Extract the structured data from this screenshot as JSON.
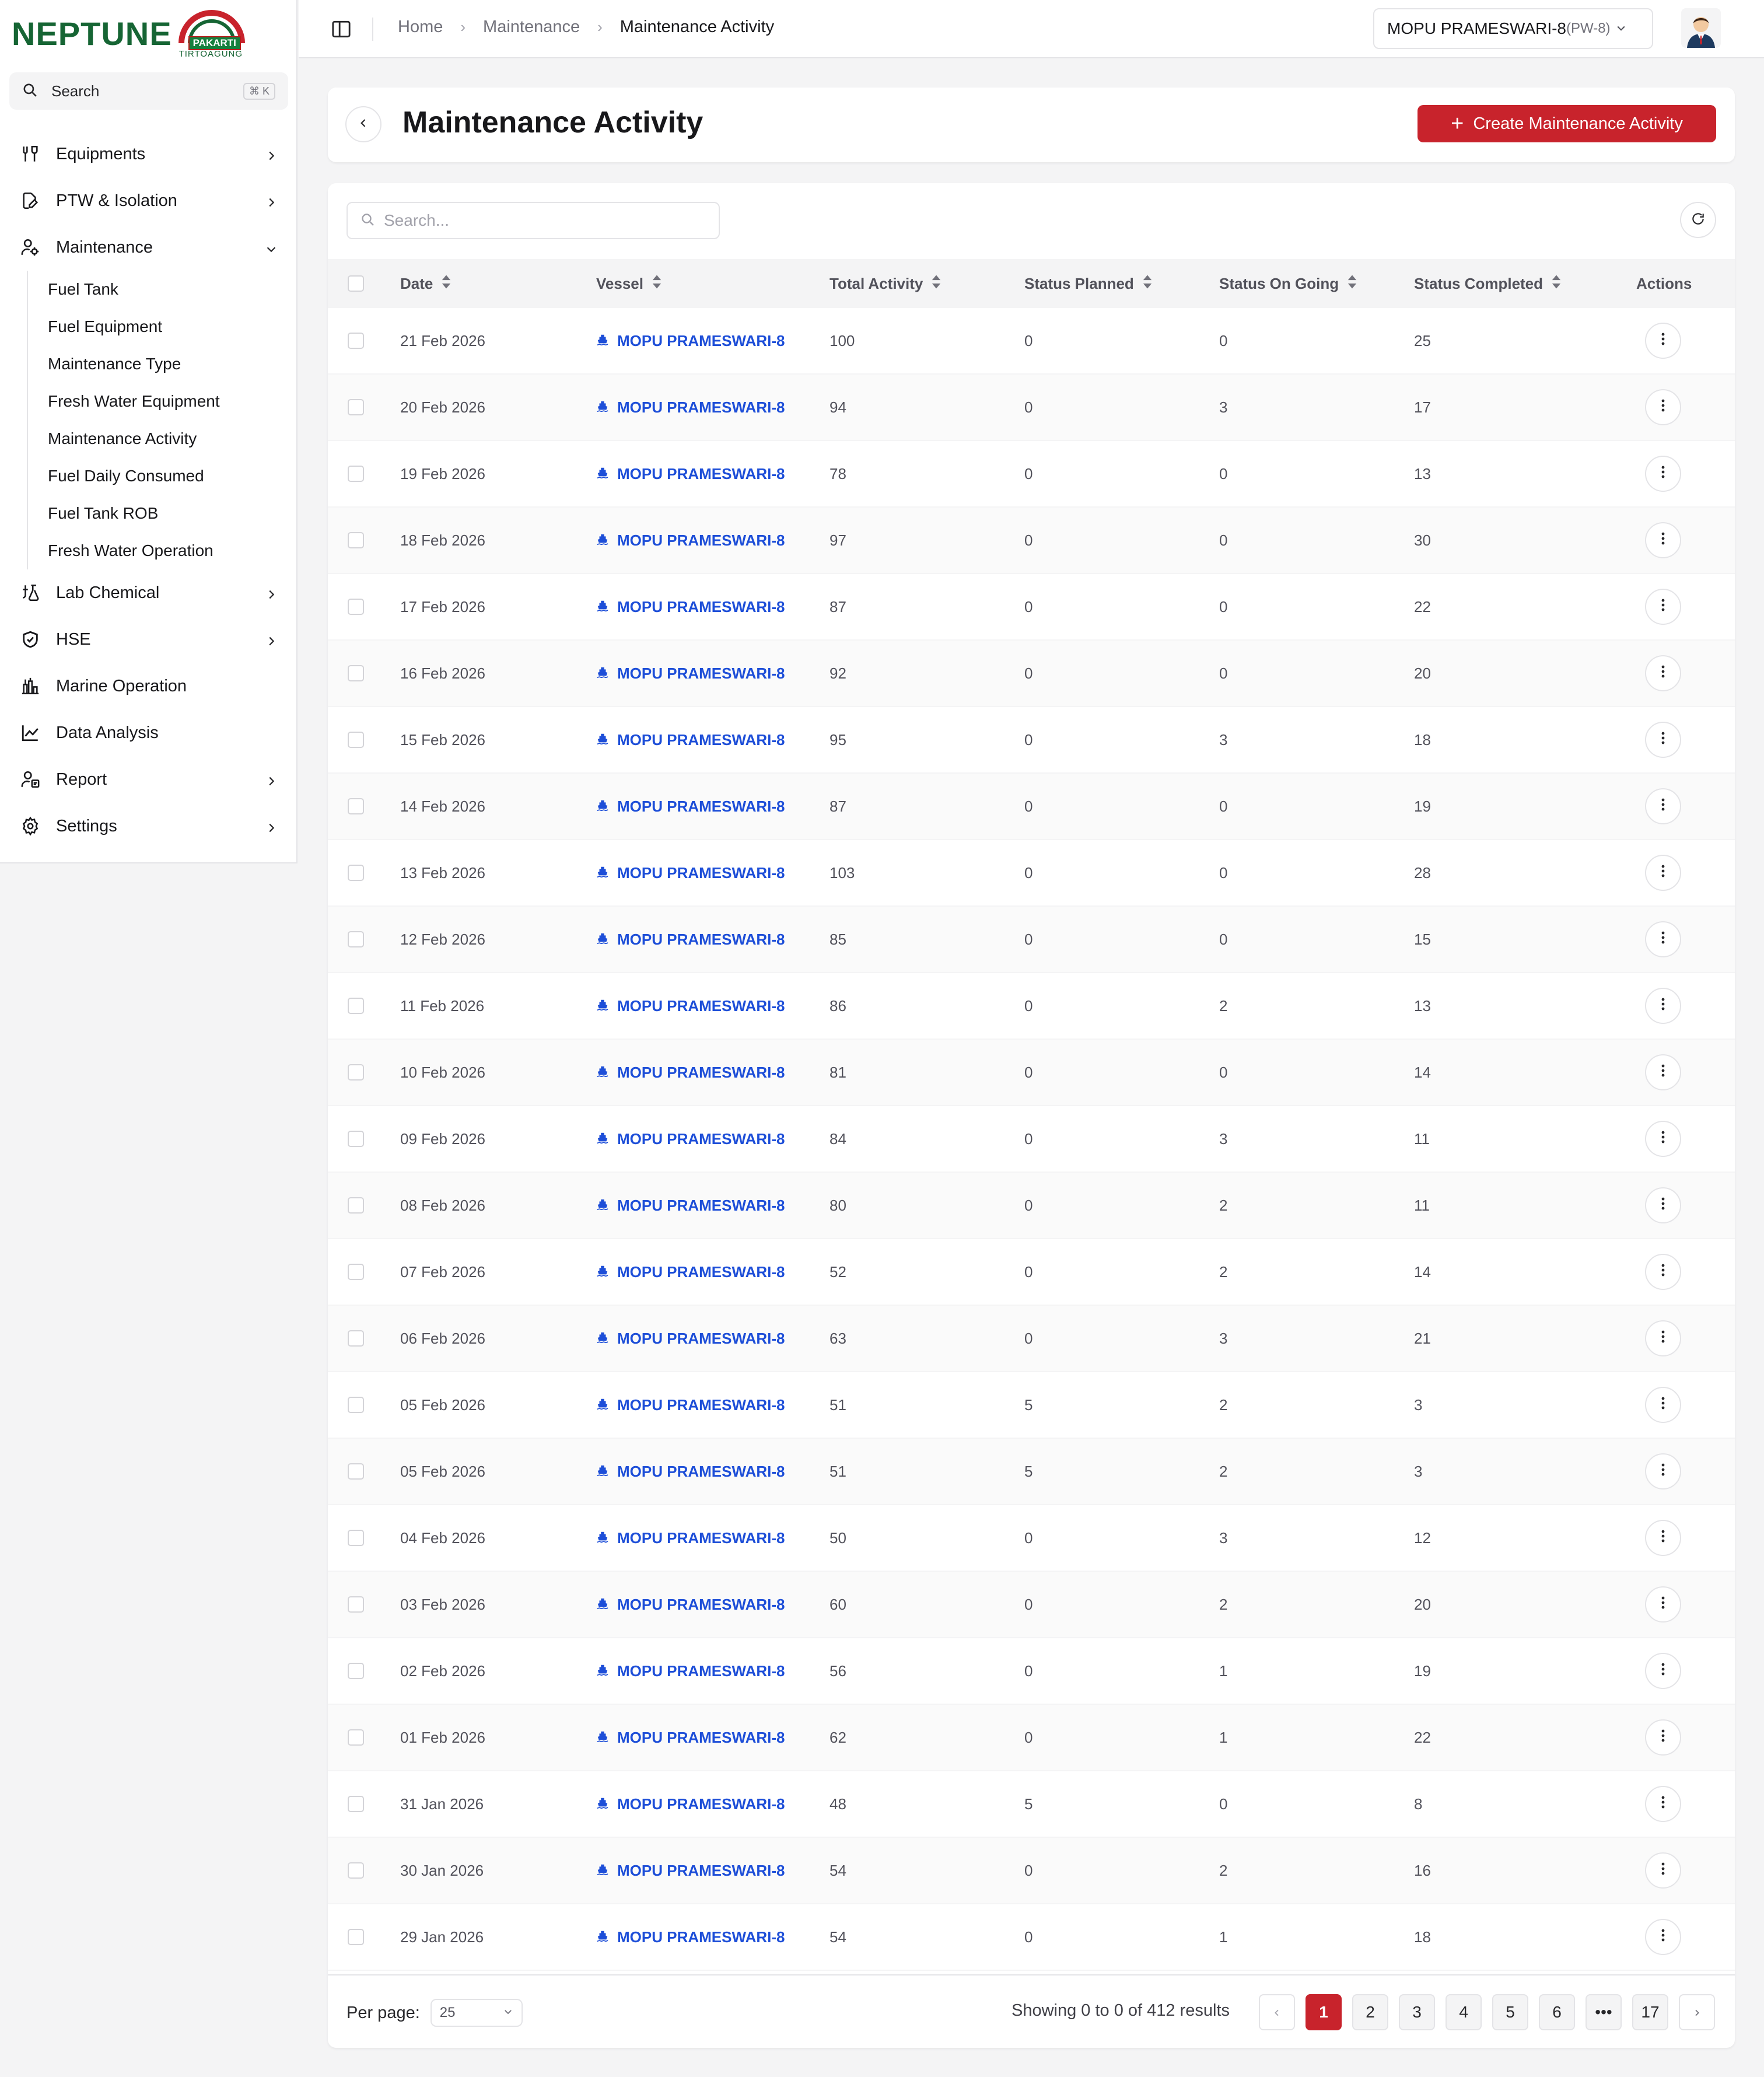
{
  "app": {
    "logo_text": "NEPTUNE",
    "logo_sub_1": "PAKARTI",
    "logo_sub_2": "TIRTOAGUNG"
  },
  "sidebar": {
    "search_label": "Search",
    "search_shortcut": "⌘ K",
    "items": [
      {
        "label": "Equipments",
        "icon": "wrench-icon",
        "has_children": true,
        "expanded": false
      },
      {
        "label": "PTW & Isolation",
        "icon": "file-edit-icon",
        "has_children": true,
        "expanded": false
      },
      {
        "label": "Maintenance",
        "icon": "users-gear-icon",
        "has_children": true,
        "expanded": true,
        "children": [
          "Fuel Tank",
          "Fuel Equipment",
          "Maintenance Type",
          "Fresh Water Equipment",
          "Maintenance Activity",
          "Fuel Daily Consumed",
          "Fuel Tank ROB",
          "Fresh Water Operation"
        ]
      },
      {
        "label": "Lab Chemical",
        "icon": "flask-icon",
        "has_children": true,
        "expanded": false
      },
      {
        "label": "HSE",
        "icon": "shield-check-icon",
        "has_children": true,
        "expanded": false
      },
      {
        "label": "Marine Operation",
        "icon": "factory-icon",
        "has_children": false,
        "expanded": false
      },
      {
        "label": "Data Analysis",
        "icon": "line-chart-icon",
        "has_children": false,
        "expanded": false
      },
      {
        "label": "Report",
        "icon": "users-report-icon",
        "has_children": true,
        "expanded": false
      },
      {
        "label": "Settings",
        "icon": "gear-icon",
        "has_children": true,
        "expanded": false
      }
    ]
  },
  "topbar": {
    "breadcrumb": [
      "Home",
      "Maintenance",
      "Maintenance Activity"
    ],
    "vessel_name": "MOPU PRAMESWARI-8",
    "vessel_code": "(PW-8)"
  },
  "header": {
    "title": "Maintenance Activity",
    "create_label": "Create Maintenance Activity"
  },
  "table": {
    "search_placeholder": "Search...",
    "columns": [
      "Date",
      "Vessel",
      "Total Activity",
      "Status Planned",
      "Status On Going",
      "Status Completed",
      "Actions"
    ],
    "rows": [
      {
        "date": "21 Feb 2026",
        "vessel": "MOPU PRAMESWARI-8",
        "total": "100",
        "planned": "0",
        "ongoing": "0",
        "completed": "25"
      },
      {
        "date": "20 Feb 2026",
        "vessel": "MOPU PRAMESWARI-8",
        "total": "94",
        "planned": "0",
        "ongoing": "3",
        "completed": "17"
      },
      {
        "date": "19 Feb 2026",
        "vessel": "MOPU PRAMESWARI-8",
        "total": "78",
        "planned": "0",
        "ongoing": "0",
        "completed": "13"
      },
      {
        "date": "18 Feb 2026",
        "vessel": "MOPU PRAMESWARI-8",
        "total": "97",
        "planned": "0",
        "ongoing": "0",
        "completed": "30"
      },
      {
        "date": "17 Feb 2026",
        "vessel": "MOPU PRAMESWARI-8",
        "total": "87",
        "planned": "0",
        "ongoing": "0",
        "completed": "22"
      },
      {
        "date": "16 Feb 2026",
        "vessel": "MOPU PRAMESWARI-8",
        "total": "92",
        "planned": "0",
        "ongoing": "0",
        "completed": "20"
      },
      {
        "date": "15 Feb 2026",
        "vessel": "MOPU PRAMESWARI-8",
        "total": "95",
        "planned": "0",
        "ongoing": "3",
        "completed": "18"
      },
      {
        "date": "14 Feb 2026",
        "vessel": "MOPU PRAMESWARI-8",
        "total": "87",
        "planned": "0",
        "ongoing": "0",
        "completed": "19"
      },
      {
        "date": "13 Feb 2026",
        "vessel": "MOPU PRAMESWARI-8",
        "total": "103",
        "planned": "0",
        "ongoing": "0",
        "completed": "28"
      },
      {
        "date": "12 Feb 2026",
        "vessel": "MOPU PRAMESWARI-8",
        "total": "85",
        "planned": "0",
        "ongoing": "0",
        "completed": "15"
      },
      {
        "date": "11 Feb 2026",
        "vessel": "MOPU PRAMESWARI-8",
        "total": "86",
        "planned": "0",
        "ongoing": "2",
        "completed": "13"
      },
      {
        "date": "10 Feb 2026",
        "vessel": "MOPU PRAMESWARI-8",
        "total": "81",
        "planned": "0",
        "ongoing": "0",
        "completed": "14"
      },
      {
        "date": "09 Feb 2026",
        "vessel": "MOPU PRAMESWARI-8",
        "total": "84",
        "planned": "0",
        "ongoing": "3",
        "completed": "11"
      },
      {
        "date": "08 Feb 2026",
        "vessel": "MOPU PRAMESWARI-8",
        "total": "80",
        "planned": "0",
        "ongoing": "2",
        "completed": "11"
      },
      {
        "date": "07 Feb 2026",
        "vessel": "MOPU PRAMESWARI-8",
        "total": "52",
        "planned": "0",
        "ongoing": "2",
        "completed": "14"
      },
      {
        "date": "06 Feb 2026",
        "vessel": "MOPU PRAMESWARI-8",
        "total": "63",
        "planned": "0",
        "ongoing": "3",
        "completed": "21"
      },
      {
        "date": "05 Feb 2026",
        "vessel": "MOPU PRAMESWARI-8",
        "total": "51",
        "planned": "5",
        "ongoing": "2",
        "completed": "3"
      },
      {
        "date": "05 Feb 2026",
        "vessel": "MOPU PRAMESWARI-8",
        "total": "51",
        "planned": "5",
        "ongoing": "2",
        "completed": "3"
      },
      {
        "date": "04 Feb 2026",
        "vessel": "MOPU PRAMESWARI-8",
        "total": "50",
        "planned": "0",
        "ongoing": "3",
        "completed": "12"
      },
      {
        "date": "03 Feb 2026",
        "vessel": "MOPU PRAMESWARI-8",
        "total": "60",
        "planned": "0",
        "ongoing": "2",
        "completed": "20"
      },
      {
        "date": "02 Feb 2026",
        "vessel": "MOPU PRAMESWARI-8",
        "total": "56",
        "planned": "0",
        "ongoing": "1",
        "completed": "19"
      },
      {
        "date": "01 Feb 2026",
        "vessel": "MOPU PRAMESWARI-8",
        "total": "62",
        "planned": "0",
        "ongoing": "1",
        "completed": "22"
      },
      {
        "date": "31 Jan 2026",
        "vessel": "MOPU PRAMESWARI-8",
        "total": "48",
        "planned": "5",
        "ongoing": "0",
        "completed": "8"
      },
      {
        "date": "30 Jan 2026",
        "vessel": "MOPU PRAMESWARI-8",
        "total": "54",
        "planned": "0",
        "ongoing": "2",
        "completed": "16"
      },
      {
        "date": "29 Jan 2026",
        "vessel": "MOPU PRAMESWARI-8",
        "total": "54",
        "planned": "0",
        "ongoing": "1",
        "completed": "18"
      }
    ]
  },
  "footer": {
    "per_page_label": "Per page:",
    "per_page_value": "25",
    "showing_text": "Showing 0 to 0 of 412 results",
    "pages": [
      "1",
      "2",
      "3",
      "4",
      "5",
      "6",
      "•••",
      "17"
    ],
    "active_page": "1"
  },
  "colors": {
    "brand_red": "#c8232c",
    "brand_green": "#166534",
    "link_blue": "#1d4ed8"
  }
}
